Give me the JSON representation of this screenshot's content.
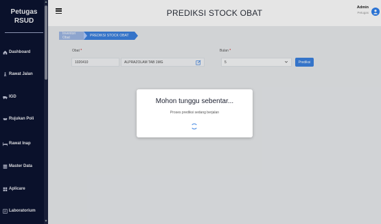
{
  "sidebar": {
    "brand_line1": "Petugas",
    "brand_line2": "RSUD",
    "items": [
      {
        "label": "Dashboard",
        "icon": "home-icon"
      },
      {
        "label": "Rawat Jalan",
        "icon": "walking-icon"
      },
      {
        "label": "IGD",
        "icon": "ambulance-icon"
      },
      {
        "label": "Rujukan Poli",
        "icon": "handshake-icon"
      },
      {
        "label": "Rawat Inap",
        "icon": "bed-icon"
      },
      {
        "label": "Master Data",
        "icon": "database-icon"
      },
      {
        "label": "Aplicare",
        "icon": "grid-icon"
      },
      {
        "label": "Laboratorium",
        "icon": "lab-icon"
      }
    ]
  },
  "header": {
    "title": "PREDIKSI STOCK OBAT",
    "user_name": "Admin",
    "user_role": "Petugas"
  },
  "breadcrumb": [
    "Inventori Obat",
    "PREDIKSI STOCK OBAT"
  ],
  "form": {
    "obat_label": "Obat",
    "obat_code": "1020410",
    "obat_name": "ALPRAZOLAM TAB 1MG",
    "bulan_label": "Bulan",
    "bulan_value": "5",
    "predict_button": "Prediksi"
  },
  "modal": {
    "title": "Mohon tunggu sebentar...",
    "subtitle": "Proses prediksi sedang berjalan"
  },
  "colors": {
    "sidebar_bg": "#0c1330",
    "accent": "#3b82e0",
    "breadcrumb_inactive": "#9fb8e6",
    "required": "#cc0000"
  }
}
